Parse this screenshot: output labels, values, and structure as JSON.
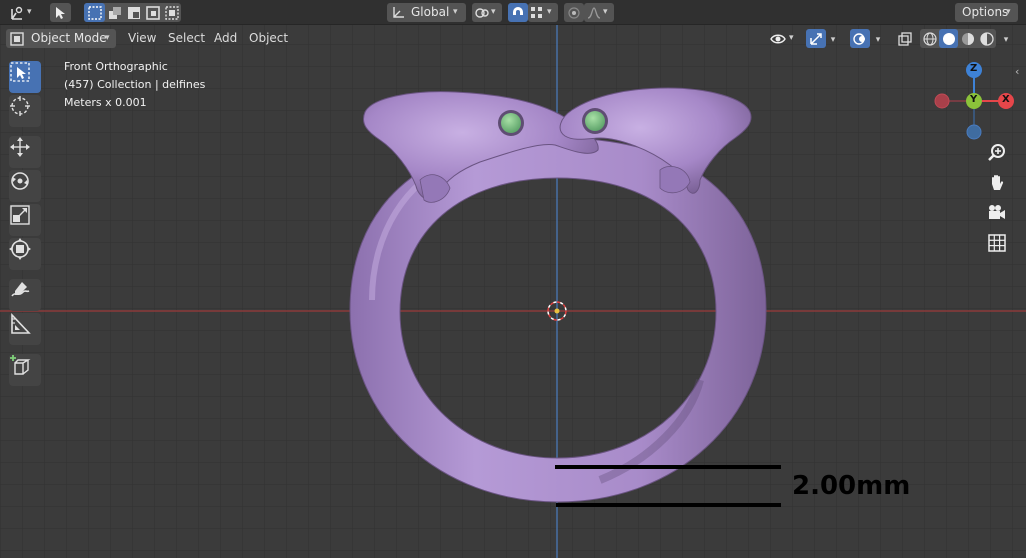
{
  "header": {
    "transform_orientation": "Global",
    "options_label": "Options"
  },
  "viewport_header": {
    "mode_label": "Object Mode",
    "menus": [
      "View",
      "Select",
      "Add",
      "Object"
    ]
  },
  "viewport_info": {
    "view_name": "Front Orthographic",
    "collection_line": "(457) Collection | delfines",
    "units_line": "Meters x 0.001"
  },
  "annotation": {
    "measurement": "2.00mm"
  },
  "gizmo": {
    "axes": [
      "Z",
      "Y",
      "X"
    ],
    "colors": {
      "x": "#e6464a",
      "y": "#8bc23a",
      "z": "#3e82d6",
      "neg_x": "#a8404a",
      "neg_z": "#3f6ca0"
    }
  },
  "colors": {
    "ring": "#a98bc9",
    "eye": "#7fc88a",
    "accent": "#4772b3",
    "grid_bg": "#3a3a3a",
    "x_axis_line": "#9b3b3b",
    "y_axis_line": "#4a7cbf"
  },
  "tools": [
    "select-box-icon",
    "cursor-icon",
    "move-icon",
    "rotate-icon",
    "scale-icon",
    "transform-icon",
    "annotate-icon",
    "measure-icon",
    "add-cube-icon"
  ],
  "nav_icons": [
    "zoom-icon",
    "hand-pan-icon",
    "camera-icon",
    "ortho-grid-icon"
  ]
}
